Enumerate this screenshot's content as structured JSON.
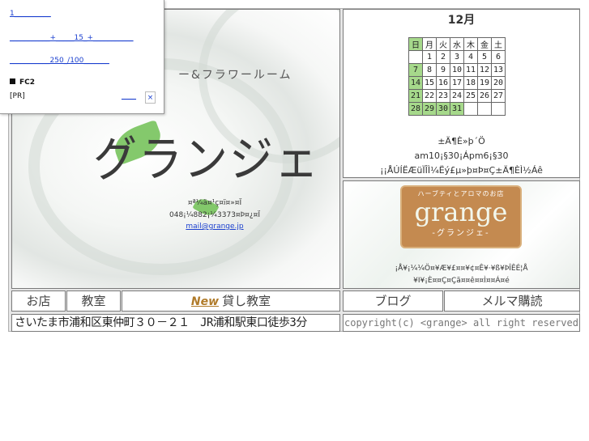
{
  "main": {
    "title": "グランジェ",
    "subtitle": "ー&フラワールーム",
    "addr_line1": "¤ª¼ä¤¹ç¤ï¤»¤Ï",
    "addr_line2": "048¡¼882¡¼3373¤Þ¤¿¤Ï",
    "email": "mail@grange.jp"
  },
  "calendar": {
    "month": "12月",
    "weekdays": [
      "日",
      "月",
      "火",
      "水",
      "木",
      "金",
      "土"
    ],
    "weeks": [
      [
        "",
        "1",
        "2",
        "3",
        "4",
        "5",
        "6"
      ],
      [
        "7",
        "8",
        "9",
        "10",
        "11",
        "12",
        "13"
      ],
      [
        "14",
        "15",
        "16",
        "17",
        "18",
        "19",
        "20"
      ],
      [
        "21",
        "22",
        "23",
        "24",
        "25",
        "26",
        "27"
      ],
      [
        "28",
        "29",
        "30",
        "31",
        "",
        "",
        ""
      ]
    ],
    "highlighted": [
      "7",
      "14",
      "21",
      "28",
      "29",
      "30",
      "31"
    ],
    "hours_label": "±Ä¶È»þ´Ö",
    "hours": "am10¡§30¡Ápm6¡§30",
    "hours_note": "¡¡ÅÚÍËÆüÏÎÌ¼Ëý£µ»þ¤Þ¤Ç±Ä¶ÈÌ½Áê"
  },
  "logo": {
    "tagline": "ハーブティとアロマのお店",
    "word": "grange",
    "kana": "-グランジェ-",
    "note1": "¡Å¥¡¼¼Ö¤¥Æ¥£¤¤¥¢¤Ê¥·¥ß¥ÞÎÊÉ¦Å",
    "note2": "¥I¥¡È¤¤Ç¤Çã¤¤ê¤¤Ì¤¤Á¤é"
  },
  "nav": {
    "shop": "お店",
    "classroom": "教室",
    "new_badge": "New",
    "rental": "貸し教室",
    "blog": "ブログ",
    "mailmag": "メルマ購読"
  },
  "footer": {
    "address": "さいたま市浦和区東仲町３０－２１　JR浦和駅東口徒歩3分",
    "copyright": "copyright(c) <grange> all right reserved"
  },
  "ad": {
    "link1": "1__________",
    "link2": "___________+_____15_+___________",
    "link3": "___________250_/100_______",
    "fc2": "FC2",
    "pr": "[PR]",
    "pr_link": "____",
    "close": "×"
  }
}
